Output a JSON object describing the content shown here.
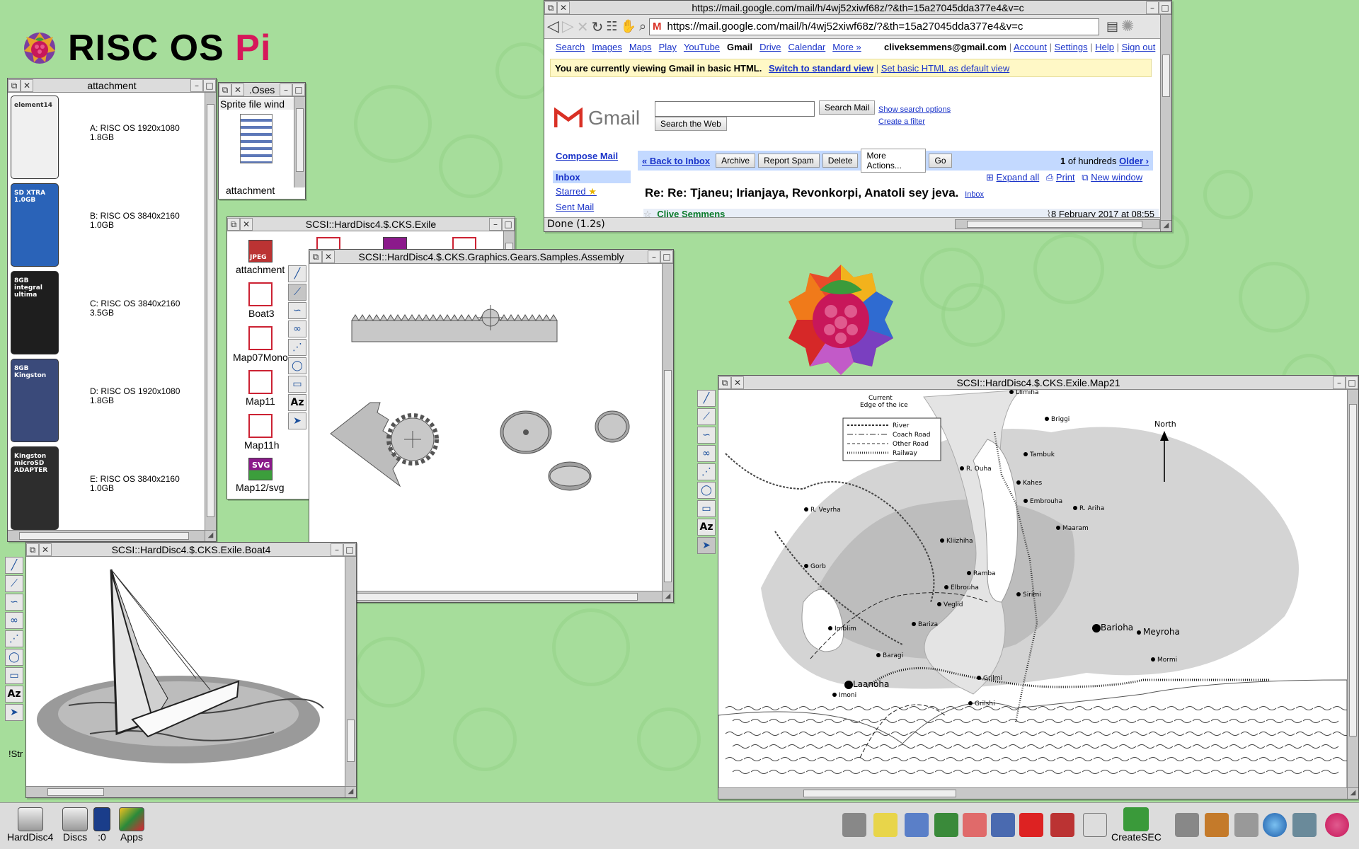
{
  "brand": {
    "text_main": "RISC OS ",
    "text_pi": "Pi"
  },
  "gmail": {
    "title": "https://mail.google.com/mail/h/4wj52xiwf68z/?&th=15a27045dda377e4&v=c",
    "url": "https://mail.google.com/mail/h/4wj52xiwf68z/?&th=15a27045dda377e4&v=c",
    "nav": [
      "Search",
      "Images",
      "Maps",
      "Play",
      "YouTube",
      "Gmail",
      "Drive",
      "Calendar",
      "More »"
    ],
    "account_email": "cliveksemmens@gmail.com",
    "account_links": [
      "Account",
      "Settings",
      "Help",
      "Sign out"
    ],
    "notice_text": "You are currently viewing Gmail in basic HTML.",
    "notice_switch": "Switch to standard view",
    "notice_default": "Set basic HTML as default view",
    "logo": "Gmail",
    "search_mail_btn": "Search Mail",
    "search_web_btn": "Search the Web",
    "show_options": "Show search options",
    "create_filter": "Create a filter",
    "compose": "Compose Mail",
    "folders": [
      "Inbox",
      "Starred",
      "Sent Mail"
    ],
    "back_inbox": "« Back to Inbox",
    "actions": [
      "Archive",
      "Report Spam",
      "Delete"
    ],
    "more_actions": "More Actions...",
    "go": "Go",
    "count_pre": "1",
    "count_mid": " of hundreds ",
    "older": "Older ›",
    "expand_all": "Expand all",
    "print": "Print",
    "new_window": "New window",
    "subject": "Re: Re: Tjaneu; Irianjaya, Revonkorpi, Anatoli sey jeva.",
    "subject_label": "Inbox",
    "sender": "Clive Semmens",
    "date": "8 February 2017 at 08:55",
    "status": "Done (1.2s)"
  },
  "attachment_window": {
    "title": "attachment",
    "cards": [
      {
        "label": "A: RISC OS 1920x1080\n1.8GB",
        "brand": "element14",
        "color": "#f0f0f0"
      },
      {
        "label": "B: RISC OS 3840x2160\n1.0GB",
        "brand": "SD XTRA 1.0GB",
        "color": "#2a63b8"
      },
      {
        "label": "C: RISC OS 3840x2160\n3.5GB",
        "brand": "8GB integral ultima",
        "color": "#1e1e1e"
      },
      {
        "label": "D: RISC OS 1920x1080\n1.8GB",
        "brand": "8GB Kingston",
        "color": "#3a4a7a"
      },
      {
        "label": "E: RISC OS 3840x2160\n1.0GB",
        "brand": "Kingston microSD ADAPTER",
        "color": "#2d2d2d"
      }
    ]
  },
  "oses_window": {
    "title": ".Oses",
    "menu": "Sprite file wind",
    "file": "attachment"
  },
  "exile_window": {
    "title": "SCSI::HardDisc4.$.CKS.Exile",
    "files": [
      "attachment",
      "Boat3",
      "Map07Mono",
      "Map11",
      "Map11h",
      "Map12/svg"
    ],
    "badge_jpeg": "JPEG",
    "badge_svg": "SVG"
  },
  "gears_window": {
    "title": "SCSI::HardDisc4.$.CKS.Graphics.Gears.Samples.Assembly"
  },
  "boat_window": {
    "title": "SCSI::HardDisc4.$.CKS.Exile.Boat4"
  },
  "map_window": {
    "title": "SCSI::HardDisc4.$.CKS.Exile.Map21",
    "legend": [
      "River",
      "Coach Road",
      "Other Road",
      "Railway"
    ],
    "north": "North",
    "top_text": [
      "Current",
      "Edge of the ice"
    ],
    "places": [
      "Llimiha",
      "Briggi",
      "Tambuk",
      "Kahes",
      "Embrouha",
      "R. Ariha",
      "R. Ouha",
      "R. Veyrha",
      "Maaram",
      "Kliizhiha",
      "Gorb",
      "Ramba",
      "Elbrouha",
      "Sirimi",
      "Veglid",
      "Imblim",
      "Bariza",
      "Baragi",
      "Laanoha",
      "Grilmi",
      "Grilshi",
      "Imoni",
      "Barioha",
      "Meyroha",
      "Mormi"
    ]
  },
  "iconbar": {
    "left": [
      "HardDisc4",
      "Discs",
      ":0",
      "Apps"
    ],
    "right_label": "CreateSEC"
  },
  "stray_label": "!Str"
}
